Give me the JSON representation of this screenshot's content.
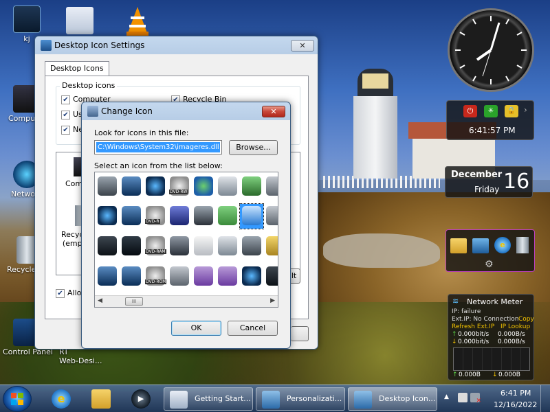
{
  "desktop": {
    "icons": [
      {
        "label": "kj"
      },
      {
        "label": "Compu"
      },
      {
        "label": "Netwo"
      },
      {
        "label": "Recycle"
      },
      {
        "label": "Control Panel"
      },
      {
        "label": "RT\nWeb-Desi..."
      }
    ]
  },
  "desktop_icon_settings": {
    "title": "Desktop Icon Settings",
    "close_label": "✕",
    "tab": "Desktop Icons",
    "group_label": "Desktop icons",
    "checkboxes": [
      "Computer",
      "Us",
      "Ne",
      "Recycle Bin"
    ],
    "preview_labels": [
      "Comp",
      "Recyc\n(emp"
    ],
    "allow_label": "Allow",
    "behind_button_label": "lt"
  },
  "change_icon": {
    "title": "Change Icon",
    "close_label": "✕",
    "look_label": "Look for icons in this file:",
    "path_value": "C:\\Windows\\System32\\imageres.dll",
    "browse_label": "Browse...",
    "select_label": "Select an icon from the list below:",
    "icon_tags": [
      "",
      "",
      "",
      "DVD-RW",
      "",
      "",
      "",
      "",
      "",
      "",
      "DVD-R",
      "",
      "",
      "",
      "",
      "",
      "",
      "",
      "DVD-RAM",
      "",
      "",
      "",
      "",
      "",
      "",
      "",
      "DVD-ROM",
      "",
      "",
      "",
      "",
      ""
    ],
    "scroll_grip": "III",
    "ok_label": "OK",
    "cancel_label": "Cancel"
  },
  "clock_gadget": {
    "time_text": "6:41:57 PM"
  },
  "calendar_gadget": {
    "month": "December",
    "weekday": "Friday",
    "day": "16"
  },
  "network_meter": {
    "title": "Network Meter",
    "ip_label": "IP: failure",
    "ext_ip_label": "Ext.IP: No Connection",
    "copy_label": "Copy",
    "refresh_label": "Refresh Ext.IP",
    "lookup_label": "IP Lookup",
    "up_bits": "0.000bit/s",
    "up_bytes": "0.000B/s",
    "down_bits": "0.000bit/s",
    "down_bytes": "0.000B/s",
    "total_up": "0.000B",
    "total_down": "0.000B"
  },
  "taskbar": {
    "items": [
      "Getting Start...",
      "Personalizati...",
      "Desktop Icon..."
    ],
    "tray_arrow": "▲",
    "time": "6:41 PM",
    "date": "12/16/2022"
  }
}
